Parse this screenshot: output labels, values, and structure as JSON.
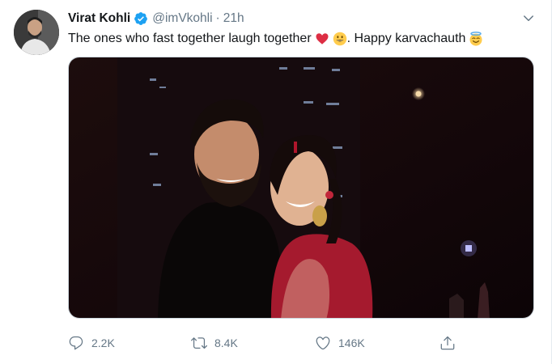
{
  "tweet": {
    "author_name": "Virat Kohli",
    "handle": "@imVkohli",
    "separator": "·",
    "time": "21h",
    "text": "The ones who fast together laugh together",
    "text_tail": ". Happy karvachauth",
    "emojis": [
      "red-heart-emoji",
      "grinning-face-emoji",
      "smiling-face-with-halo-emoji"
    ]
  },
  "actions": {
    "replies": "2.2K",
    "retweets": "8.4K",
    "likes": "146K"
  },
  "colors": {
    "verified_blue": "#1da1f2",
    "secondary_text": "#657786",
    "heart_red": "#e0245e"
  }
}
